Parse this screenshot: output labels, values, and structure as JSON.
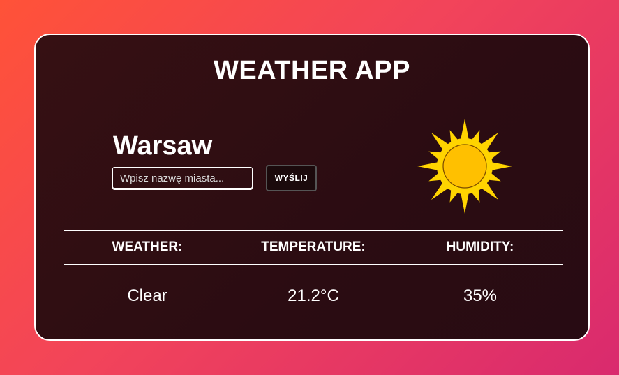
{
  "app": {
    "title": "WEATHER APP"
  },
  "location": {
    "city": "Warsaw"
  },
  "search": {
    "placeholder": "Wpisz nazwę miasta...",
    "value": "",
    "submit_label": "WYŚLIJ"
  },
  "icon": {
    "name": "sun-icon",
    "ray_color": "#ffd400",
    "core_color": "#ffc000",
    "outline_color": "#7a4a00"
  },
  "details": {
    "headers": [
      "WEATHER:",
      "TEMPERATURE:",
      "HUMIDITY:"
    ],
    "values": [
      "Clear",
      "21.2°C",
      "35%"
    ]
  }
}
